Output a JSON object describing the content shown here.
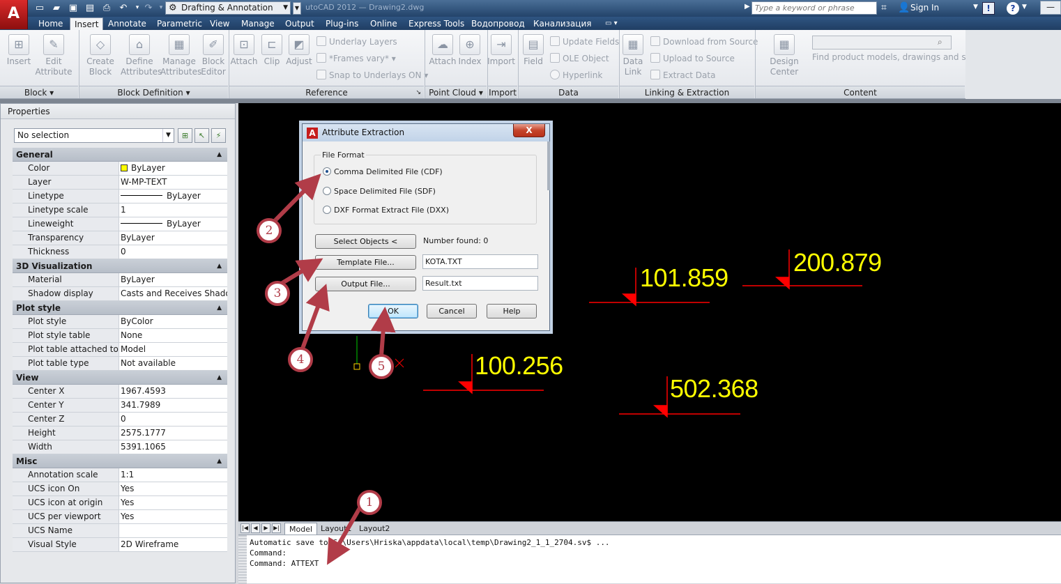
{
  "app": {
    "logo_letter": "A",
    "workspace": "Drafting & Annotation",
    "window_title_faded": "utoCAD 2012 — Drawing2.dwg",
    "search_placeholder": "Type a keyword or phrase",
    "sign_in": "Sign In"
  },
  "ribbon": {
    "tabs": [
      "Home",
      "Insert",
      "Annotate",
      "Parametric",
      "View",
      "Manage",
      "Output",
      "Plug-ins",
      "Online",
      "Express Tools",
      "Водопровод",
      "Канализация"
    ],
    "active_tab": "Insert",
    "block_panel": {
      "title": "Block",
      "insert": "Insert",
      "edit_attribute_1": "Edit",
      "edit_attribute_2": "Attribute"
    },
    "block_def_panel": {
      "title": "Block Definition",
      "create_1": "Create",
      "create_2": "Block",
      "define_1": "Define",
      "define_2": "Attributes",
      "manage_1": "Manage",
      "manage_2": "Attributes",
      "editor_1": "Block",
      "editor_2": "Editor"
    },
    "reference_panel": {
      "title": "Reference",
      "attach": "Attach",
      "clip": "Clip",
      "adjust": "Adjust",
      "underlay_layers": "Underlay Layers",
      "frames_vary": "*Frames vary*",
      "snap_underlays": "Snap to Underlays ON"
    },
    "pointcloud_panel": {
      "title": "Point Cloud",
      "attach": "Attach",
      "index": "Index"
    },
    "import_panel": {
      "title": "Import",
      "import": "Import"
    },
    "data_panel": {
      "title": "Data",
      "field": "Field",
      "update_fields": "Update Fields",
      "ole_object": "OLE Object",
      "hyperlink": "Hyperlink"
    },
    "linking_panel": {
      "title": "Linking & Extraction",
      "data_link_1": "Data",
      "data_link_2": "Link",
      "download": "Download from Source",
      "upload": "Upload to Source",
      "extract": "Extract  Data"
    },
    "content_panel": {
      "title": "Content",
      "design_center": "Design Center",
      "hint": "Find product models, drawings and specs"
    }
  },
  "properties": {
    "title": "Properties",
    "selection": "No selection",
    "sections": [
      {
        "name": "General",
        "rows": [
          [
            "Color",
            "ByLayer"
          ],
          [
            "Layer",
            "W-MP-TEXT"
          ],
          [
            "Linetype",
            "ByLayer"
          ],
          [
            "Linetype scale",
            "1"
          ],
          [
            "Lineweight",
            "ByLayer"
          ],
          [
            "Transparency",
            "ByLayer"
          ],
          [
            "Thickness",
            "0"
          ]
        ]
      },
      {
        "name": "3D Visualization",
        "rows": [
          [
            "Material",
            "ByLayer"
          ],
          [
            "Shadow display",
            "Casts and Receives Shadows"
          ]
        ]
      },
      {
        "name": "Plot style",
        "rows": [
          [
            "Plot style",
            "ByColor"
          ],
          [
            "Plot style table",
            "None"
          ],
          [
            "Plot table attached to",
            "Model"
          ],
          [
            "Plot table type",
            "Not available"
          ]
        ]
      },
      {
        "name": "View",
        "rows": [
          [
            "Center X",
            "1967.4593"
          ],
          [
            "Center Y",
            "341.7989"
          ],
          [
            "Center Z",
            "0"
          ],
          [
            "Height",
            "2575.1777"
          ],
          [
            "Width",
            "5391.1065"
          ]
        ]
      },
      {
        "name": "Misc",
        "rows": [
          [
            "Annotation scale",
            "1:1"
          ],
          [
            "UCS icon On",
            "Yes"
          ],
          [
            "UCS icon at origin",
            "Yes"
          ],
          [
            "UCS per viewport",
            "Yes"
          ],
          [
            "UCS Name",
            ""
          ],
          [
            "Visual Style",
            "2D Wireframe"
          ]
        ]
      }
    ]
  },
  "dialog": {
    "title": "Attribute Extraction",
    "close": "X",
    "file_format_label": "File Format",
    "cdf": "Comma Delimited File (CDF)",
    "sdf": "Space Delimited File (SDF)",
    "dxf": "DXF Format Extract File (DXX)",
    "select_objects": "Select Objects <",
    "number_found": "Number found:  0",
    "template_file": "Template File...",
    "template_value": "KOTA.TXT",
    "output_file": "Output File...",
    "output_value": "Result.txt",
    "ok": "OK",
    "cancel": "Cancel",
    "help": "Help"
  },
  "drawing": {
    "elevations": [
      "101.859",
      "200.879",
      "100.256",
      "502.368"
    ],
    "annotation_color": "#b13c48",
    "text_color": "#ffff00",
    "leader_color": "#ff0000"
  },
  "steps": [
    "1",
    "2",
    "3",
    "4",
    "5"
  ],
  "layout_tabs": [
    "Model",
    "Layout1",
    "Layout2"
  ],
  "command_line": {
    "line1": "Automatic save to C:\\Users\\Hriska\\appdata\\local\\temp\\Drawing2_1_1_2704.sv$ ...",
    "line2": "Command:",
    "line3": "Command: ATTEXT"
  }
}
